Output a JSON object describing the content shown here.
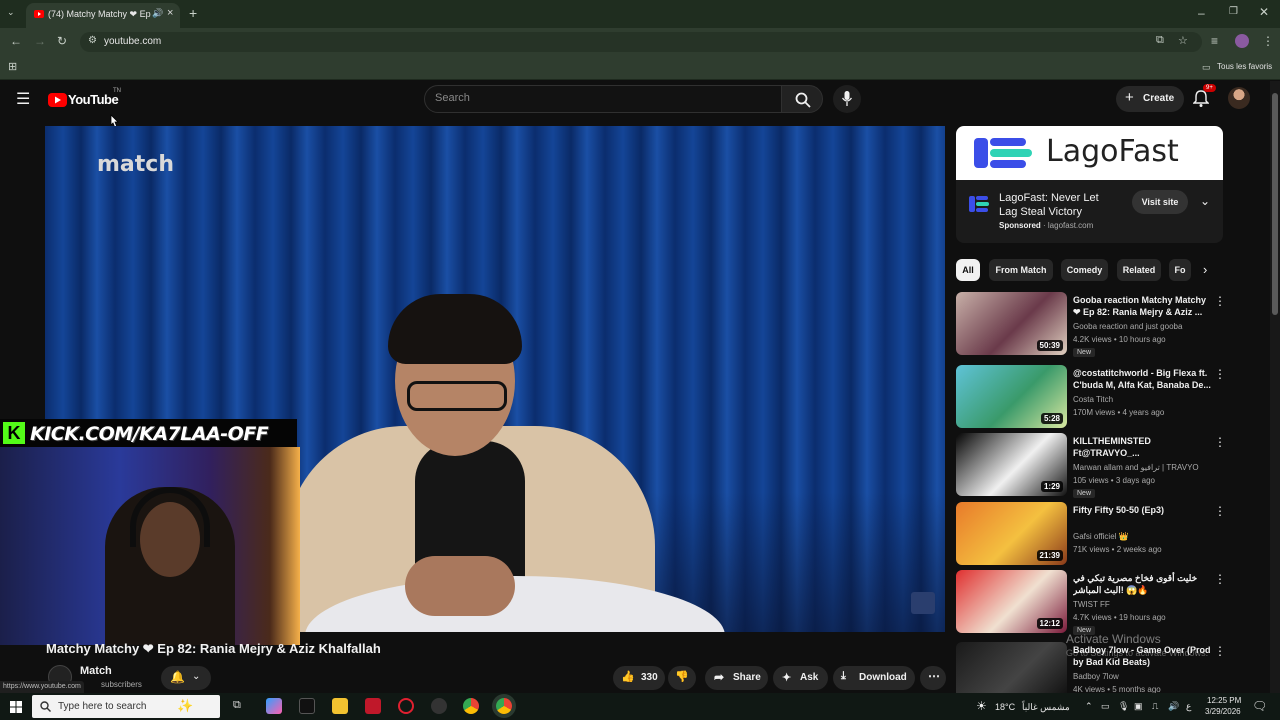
{
  "browser": {
    "tab_title": "(74) Matchy Matchy ❤ Ep",
    "url": "youtube.com",
    "bookmarks_label": "Tous les favoris"
  },
  "youtube": {
    "logo_text": "YouTube",
    "logo_suffix": "TN",
    "search_placeholder": "Search",
    "create_label": "Create",
    "notif_count": "9+"
  },
  "video": {
    "title": "Matchy Matchy ❤ Ep 82: Rania Mejry & Aziz Khalfallah",
    "overlay_logo": "match",
    "kick_text": "KICK.COM/KA7LAA-OFF",
    "kick_letter": "K",
    "channel_name": "Match",
    "channel_subs": "subscribers",
    "likes": "330",
    "share_label": "Share",
    "ask_label": "Ask",
    "download_label": "Download",
    "status_url": "https://www.youtube.com"
  },
  "ad": {
    "brand": "LagoFast",
    "title": "LagoFast: Never Let Lag Steal Victory",
    "sponsored": "Sponsored",
    "domain": "lagofast.com",
    "cta": "Visit site"
  },
  "chips": [
    "All",
    "From Match",
    "Comedy",
    "Related",
    "Fo"
  ],
  "recommendations": [
    {
      "title": "Gooba reaction Matchy Matchy ❤ Ep 82: Rania Mejry & Aziz ...",
      "channel": "Gooba reaction and just gooba",
      "meta": "4.2K views • 10 hours ago",
      "tag": "New",
      "duration": "50:39",
      "thumb_colors": [
        "#c8b0a8",
        "#6a3a4a",
        "#e0d0c0"
      ]
    },
    {
      "title": "@costatitchworld - Big Flexa ft. C'buda M, Alfa Kat, Banaba De...",
      "channel": "Costa Titch",
      "meta": "170M views • 4 years ago",
      "tag": "",
      "duration": "5:28",
      "thumb_colors": [
        "#5fc3d8",
        "#3a9a6a",
        "#d8e8a0"
      ]
    },
    {
      "title": "KILLTHEMINSTED Ft@TRAVYO_...",
      "channel": "Marwan allam and ترافيو | TRAVYO",
      "meta": "105 views • 3 days ago",
      "tag": "New",
      "duration": "1:29",
      "thumb_colors": [
        "#050505",
        "#f0f0f0",
        "#111111"
      ]
    },
    {
      "title": "Fifty Fifty 50-50 (Ep3)",
      "channel": "Gafsi officiel 👑",
      "meta": "71K views • 2 weeks ago",
      "tag": "",
      "duration": "21:39",
      "thumb_colors": [
        "#e87a2a",
        "#f4c040",
        "#8a3a1a"
      ]
    },
    {
      "title": "خليت أقوى فخاخ مصرية تبكي في البث المباشر! 😱🔥",
      "channel": "TWIST FF",
      "meta": "4.7K views • 19 hours ago",
      "tag": "New",
      "duration": "12:12",
      "thumb_colors": [
        "#e03030",
        "#f0e0d0",
        "#7a1a3a"
      ]
    },
    {
      "title": "Badboy 7low - Game Over (Prod by Bad Kid Beats)",
      "channel": "Badboy 7low",
      "meta": "4K views • 5 months ago",
      "tag": "",
      "duration": "",
      "thumb_colors": [
        "#1a1a1a",
        "#444444",
        "#0a0a0a"
      ]
    }
  ],
  "windows": {
    "activate_title": "Activate Windows",
    "activate_sub": "Go to Settings to activate Windows.",
    "search_placeholder": "Type here to search",
    "temperature": "18°C",
    "weather": "مشمس غالباً",
    "time": "12:25 PM",
    "date": "3/29/2026",
    "lang": "ع"
  },
  "colors": {
    "yt_red": "#ff0000",
    "kick_green": "#53fc18",
    "ad_blue": "#3b4ee8",
    "ad_teal": "#2fd3b5"
  }
}
